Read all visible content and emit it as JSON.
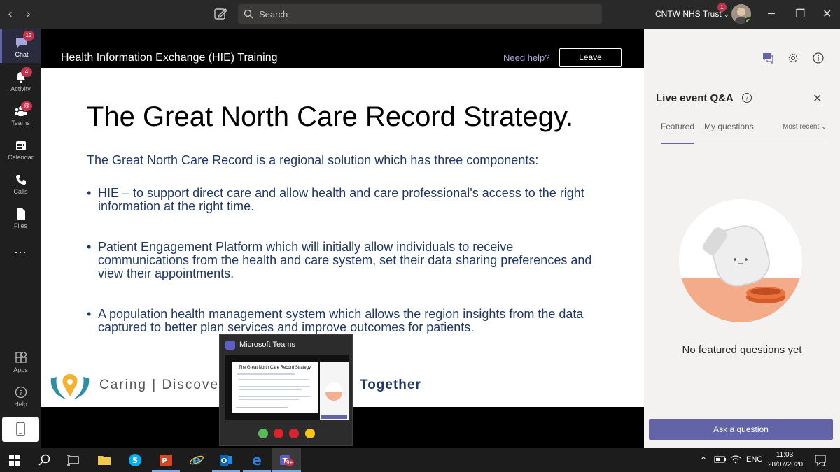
{
  "topbar": {
    "search_placeholder": "Search",
    "org_name": "CNTW NHS Trust",
    "org_badge": "1"
  },
  "rail": {
    "items": [
      {
        "label": "Chat",
        "badge": "12"
      },
      {
        "label": "Activity",
        "badge": "4"
      },
      {
        "label": "Teams",
        "badge": "@"
      },
      {
        "label": "Calendar",
        "badge": ""
      },
      {
        "label": "Calls",
        "badge": ""
      },
      {
        "label": "Files",
        "badge": ""
      },
      {
        "label": "...",
        "badge": ""
      },
      {
        "label": "Apps",
        "badge": ""
      },
      {
        "label": "Help",
        "badge": ""
      }
    ]
  },
  "event": {
    "title": "Health Information Exchange (HIE) Training",
    "help_label": "Need help?",
    "leave_label": "Leave"
  },
  "slide": {
    "title": "The Great North Care Record Strategy.",
    "intro": "The Great North Care Record is a regional solution which has three components:",
    "bullets": [
      "HIE – to support direct care and allow health and care professional's access to the right information at the right time.",
      "Patient Engagement Platform which will initially allow individuals to receive communications from the health and care system, set their data sharing preferences and view their appointments.",
      "A population health management system which allows the region insights from the data captured to better plan services and improve outcomes for patients."
    ],
    "tagline_start": "Caring | Discove",
    "tagline_end": "Together"
  },
  "popup": {
    "title": "Microsoft Teams",
    "mini_title": "The Great North Care Record Strategy."
  },
  "panel": {
    "title": "Live event Q&A",
    "tabs": [
      "Featured",
      "My questions"
    ],
    "sort_label": "Most recent",
    "empty_message": "No featured questions yet",
    "ask_label": "Ask a question"
  },
  "taskbar": {
    "teams_badge": "9+",
    "language": "ENG",
    "time": "11:03",
    "date": "28/07/2020",
    "notification_count": "1"
  },
  "colors": {
    "accent": "#6264a7",
    "badge_red": "#c4314b",
    "slide_text": "#1f3864"
  }
}
